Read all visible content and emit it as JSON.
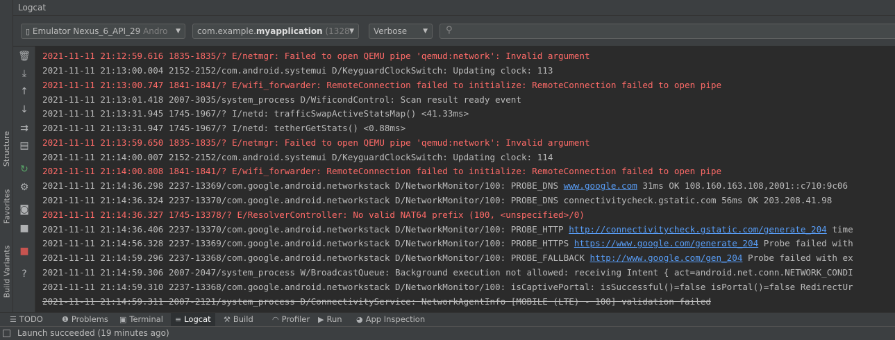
{
  "header": {
    "title": "Logcat"
  },
  "toolbar": {
    "device_combo": {
      "prefix": "Emulator Nexus_6_API_29",
      "suffix": " Andro",
      "icon": "device-icon"
    },
    "process_combo": {
      "prefix": "com.example.",
      "bold": "myapplication",
      "suffix": " (1328:"
    },
    "level_combo": {
      "value": "Verbose"
    },
    "search": {
      "placeholder": "",
      "icon": "search-icon"
    }
  },
  "side_icons": [
    "trash-icon",
    "scroll-to-end-icon",
    "arrow-up-icon",
    "arrow-down-icon",
    "soft-wrap-icon",
    "print-icon",
    "restart-icon",
    "settings-icon",
    "screenshot-icon",
    "screen-record-icon",
    "stop-icon",
    "help-icon"
  ],
  "left_strip": {
    "structure": "Structure",
    "favorites": "Favorites",
    "build_variants": "Build Variants"
  },
  "log_lines": [
    {
      "text": "2021-11-11 21:12:59.616 1835-1835/? E/netmgr: Failed to open QEMU pipe 'qemud:network': Invalid argument",
      "level": "E"
    },
    {
      "text": "2021-11-11 21:13:00.004 2152-2152/com.android.systemui D/KeyguardClockSwitch: Updating clock: 113",
      "level": "D"
    },
    {
      "text": "2021-11-11 21:13:00.747 1841-1841/? E/wifi_forwarder: RemoteConnection failed to initialize: RemoteConnection failed to open pipe",
      "level": "E"
    },
    {
      "text": "2021-11-11 21:13:01.418 2007-3035/system_process D/WificondControl: Scan result ready event",
      "level": "D"
    },
    {
      "text": "2021-11-11 21:13:31.945 1745-1967/? I/netd: trafficSwapActiveStatsMap() <41.33ms>",
      "level": "I"
    },
    {
      "text": "2021-11-11 21:13:31.947 1745-1967/? I/netd: tetherGetStats() <0.88ms>",
      "level": "I"
    },
    {
      "text": "2021-11-11 21:13:59.650 1835-1835/? E/netmgr: Failed to open QEMU pipe 'qemud:network': Invalid argument",
      "level": "E"
    },
    {
      "text": "2021-11-11 21:14:00.007 2152-2152/com.android.systemui D/KeyguardClockSwitch: Updating clock: 114",
      "level": "D"
    },
    {
      "text": "2021-11-11 21:14:00.808 1841-1841/? E/wifi_forwarder: RemoteConnection failed to initialize: RemoteConnection failed to open pipe",
      "level": "E"
    },
    {
      "text": "2021-11-11 21:14:36.298 2237-13369/com.google.android.networkstack D/NetworkMonitor/100: PROBE_DNS ",
      "link": "www.google.com",
      "after": " 31ms OK 108.160.163.108,2001::c710:9c06",
      "level": "D"
    },
    {
      "text": "2021-11-11 21:14:36.324 2237-13370/com.google.android.networkstack D/NetworkMonitor/100: PROBE_DNS connectivitycheck.gstatic.com 56ms OK 203.208.41.98",
      "level": "D"
    },
    {
      "text": "2021-11-11 21:14:36.327 1745-13378/? E/ResolverController: No valid NAT64 prefix (100, <unspecified>/0)",
      "level": "E"
    },
    {
      "text": "2021-11-11 21:14:36.406 2237-13370/com.google.android.networkstack D/NetworkMonitor/100: PROBE_HTTP ",
      "link": "http://connectivitycheck.gstatic.com/generate_204",
      "after": " time",
      "level": "D"
    },
    {
      "text": "2021-11-11 21:14:56.328 2237-13369/com.google.android.networkstack D/NetworkMonitor/100: PROBE_HTTPS ",
      "link": "https://www.google.com/generate_204",
      "after": " Probe failed with",
      "level": "D"
    },
    {
      "text": "2021-11-11 21:14:59.296 2237-13368/com.google.android.networkstack D/NetworkMonitor/100: PROBE_FALLBACK ",
      "link": "http://www.google.com/gen_204",
      "after": " Probe failed with ex",
      "level": "D"
    },
    {
      "text": "2021-11-11 21:14:59.306 2007-2047/system_process W/BroadcastQueue: Background execution not allowed: receiving Intent { act=android.net.conn.NETWORK_CONDI",
      "level": "W"
    },
    {
      "text": "2021-11-11 21:14:59.310 2237-13368/com.google.android.networkstack D/NetworkMonitor/100: isCaptivePortal: isSuccessful()=false isPortal()=false RedirectUr",
      "level": "D"
    },
    {
      "text": "2021-11-11 21:14:59.311 2007-2121/system_process D/ConnectivityService: NetworkAgentInfo [MOBILE (LTE) - 100] validation failed",
      "level": "D",
      "strike": true
    }
  ],
  "bottom_tabs": [
    {
      "label": "TODO",
      "icon": "todo-icon",
      "glyph": "☰"
    },
    {
      "label": "Problems",
      "icon": "problems-icon",
      "glyph": "❶"
    },
    {
      "label": "Terminal",
      "icon": "terminal-icon",
      "glyph": "▣"
    },
    {
      "label": "Logcat",
      "icon": "logcat-icon",
      "glyph": "≡",
      "active": true
    },
    {
      "label": "Build",
      "icon": "build-hammer-icon",
      "glyph": "⚒"
    },
    {
      "label": "Profiler",
      "icon": "profiler-icon",
      "glyph": "◠"
    },
    {
      "label": "Run",
      "icon": "run-icon",
      "glyph": "▶"
    },
    {
      "label": "App Inspection",
      "icon": "app-inspection-icon",
      "glyph": "◕"
    }
  ],
  "status_bar": {
    "text": "Launch succeeded (19 minutes ago)",
    "icon": "tool-window-icon"
  },
  "colors": {
    "error": "#ff6b68",
    "link": "#589df6",
    "text": "#bbbbbb",
    "background": "#2b2b2b",
    "panel": "#3c3f41"
  }
}
